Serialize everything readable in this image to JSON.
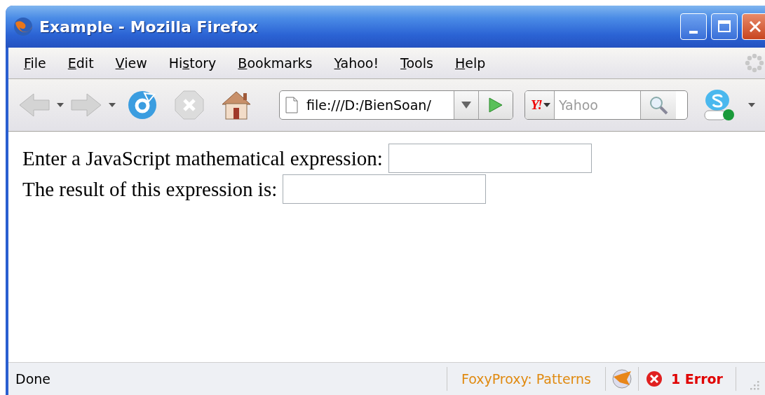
{
  "window": {
    "title": "Example - Mozilla Firefox"
  },
  "menu": [
    {
      "key": "F",
      "after": "ile"
    },
    {
      "key": "E",
      "after": "dit"
    },
    {
      "key": "V",
      "after": "iew"
    },
    {
      "before": "Hi",
      "key": "s",
      "after": "tory"
    },
    {
      "key": "B",
      "after": "ookmarks"
    },
    {
      "key": "Y",
      "after": "ahoo!"
    },
    {
      "key": "T",
      "after": "ools"
    },
    {
      "key": "H",
      "after": "elp"
    }
  ],
  "toolbar": {
    "back": {
      "disabled": true
    },
    "forward": {
      "disabled": true
    },
    "stop": {
      "disabled": true
    },
    "address": {
      "value": "file:///D:/BienSoan/"
    },
    "search": {
      "engine_logo": "Y!",
      "placeholder": "Yahoo"
    }
  },
  "page": {
    "lines": [
      {
        "label": "Enter a JavaScript mathematical expression:"
      },
      {
        "label": "The result of this expression is:"
      }
    ]
  },
  "status_bar": {
    "text": "Done",
    "proxy": "FoxyProxy: Patterns",
    "errors": "1 Error"
  }
}
